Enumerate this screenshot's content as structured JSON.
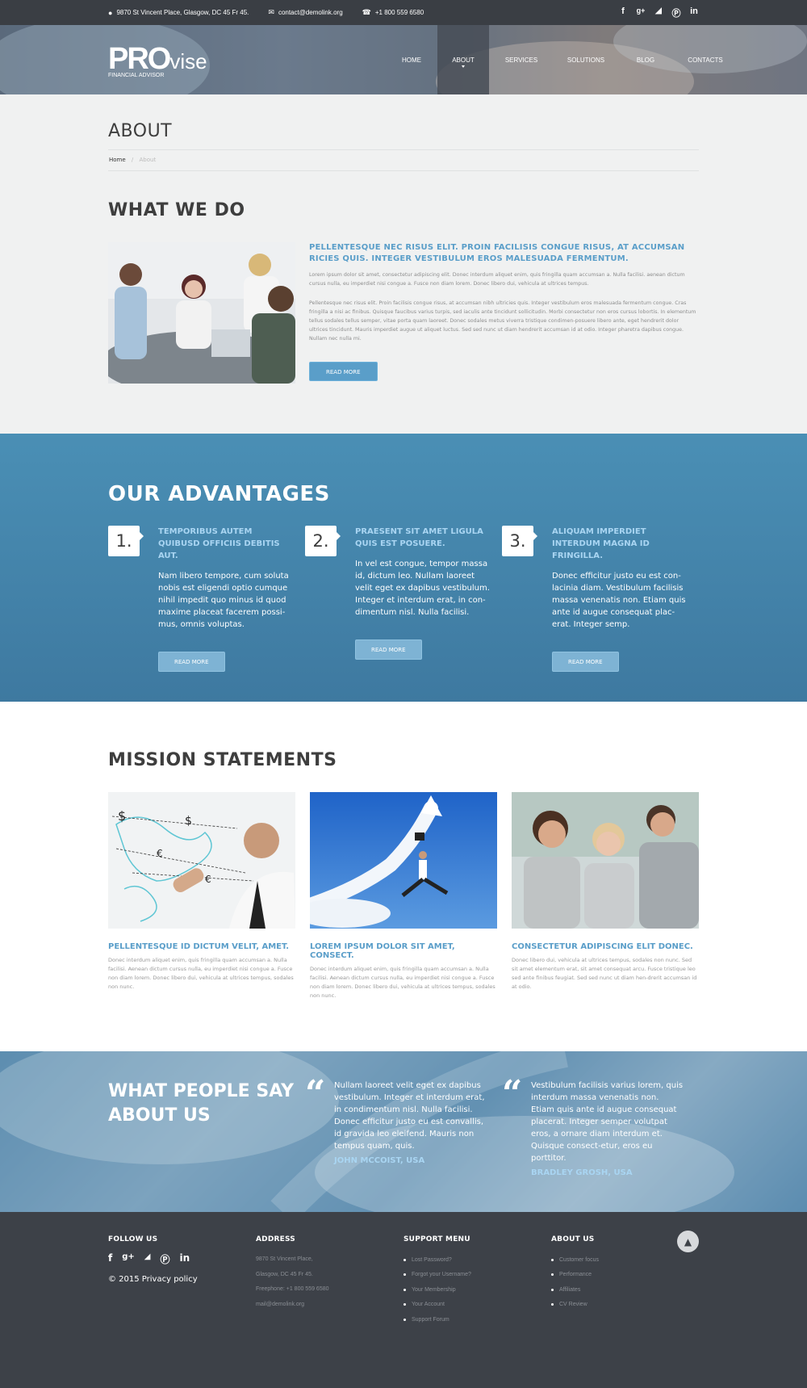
{
  "topbar": {
    "address": "9870 St Vincent Place, Glasgow, DC 45 Fr 45.",
    "email": "contact@demolink.org",
    "phone": "+1 800 559 6580",
    "social": [
      "f",
      "g+",
      "rss",
      "p",
      "in"
    ]
  },
  "logo": {
    "pro": "PRO",
    "vise": "vise",
    "sub": "FINANCIAL ADVISOR"
  },
  "nav": [
    "HOME",
    "ABOUT",
    "SERVICES",
    "SOLUTIONS",
    "BLOG",
    "CONTACTS"
  ],
  "nav_active": "ABOUT",
  "about": {
    "title": "ABOUT",
    "breadcrumb_home": "Home",
    "breadcrumb_sep": "/",
    "breadcrumb_current": "About",
    "section_title": "WHAT WE DO",
    "heading": "PELLENTESQUE NEC RISUS ELIT. PROIN FACILISIS CONGUE RISUS, AT ACCUMSAN RICIES QUIS. INTEGER VESTIBULUM EROS MALESUADA FERMENTUM.",
    "p1": "Lorem ipsum dolor sit amet, consectetur adipiscing elit. Donec interdum aliquet enim, quis fringilla quam accumsan a. Nulla facilisi. aenean dictum cursus nulla, eu imperdiet nisi congue a. Fusce non diam lorem. Donec libero dui, vehicula at ultrices tempus.",
    "p2": "Pellentesque nec risus elit. Proin facilisis congue risus, at accumsan nibh ultricies quis. Integer vestibulum eros malesuada fermentum congue. Cras fringilla a nisi ac finibus. Quisque faucibus varius turpis, sed iaculis ante tincidunt sollicitudin. Morbi consectetur non eros cursus lobortis. In elementum tellus sodales tellus semper, vitae porta quam laoreet. Donec sodales metus viverra tristique condimen-posuere libero ante, eget hendrerit dolor ultrices tincidunt. Mauris imperdiet augue ut aliquet luctus. Sed sed nunc ut diam hendrerit accumsan id at odio. Integer pharetra dapibus congue. Nullam nec nulla mi.",
    "button": "READ MORE"
  },
  "advantages": {
    "title": "OUR ADVANTAGES",
    "items": [
      {
        "num": "1.",
        "head": "TEMPORIBUS AUTEM QUIBUSD OFFICIIS DEBITIS AUT.",
        "text": "Nam libero tempore, cum soluta nobis est eligendi optio cumque nihil impedit quo minus id quod maxime placeat facerem possi-mus, omnis voluptas.",
        "button": "READ MORE"
      },
      {
        "num": "2.",
        "head": "PRAESENT SIT AMET LIGULA QUIS EST POSUERE.",
        "text": "In vel est congue, tempor massa id, dictum leo. Nullam laoreet velit eget ex dapibus vestibulum. Integer et interdum erat, in con-dimentum nisl. Nulla facilisi.",
        "button": "READ MORE"
      },
      {
        "num": "3.",
        "head": "ALIQUAM IMPERDIET INTERDUM MAGNA ID FRINGILLA.",
        "text": "Donec efficitur justo eu est con-lacinia diam. Vestibulum facilisis massa venenatis non. Etiam quis ante id augue consequat plac-erat. Integer semp.",
        "button": "READ MORE"
      }
    ]
  },
  "mission": {
    "title": "MISSION STATEMENTS",
    "items": [
      {
        "head": "PELLENTESQUE ID DICTUM VELIT, AMET.",
        "text": "Donec interdum aliquet enim, quis fringilla quam accumsan a. Nulla facilisi. Aenean dictum cursus nulla, eu imperdiet nisi congue a. Fusce non diam lorem. Donec libero dui, vehicula at ultrices tempus, sodales non nunc."
      },
      {
        "head": "LOREM IPSUM DOLOR SIT AMET, CONSECT.",
        "text": "Donec interdum aliquet enim, quis fringilla quam accumsan a. Nulla facilisi. Aenean dictum cursus nulla, eu imperdiet nisi congue a. Fusce non diam lorem. Donec libero dui, vehicula at ultrices tempus, sodales non nunc."
      },
      {
        "head": "CONSECTETUR ADIPISCING ELIT DONEC.",
        "text": "Donec libero dui, vehicula at ultrices tempus, sodales non nunc. Sed sit amet elementum erat, sit amet consequat arcu. Fusce tristique leo sed ante finibus feugiat. Sed sed nunc ut diam hen-drerit accumsan id at odio."
      }
    ]
  },
  "testimonials": {
    "title": "WHAT PEOPLE SAY ABOUT US",
    "items": [
      {
        "text": "Nullam laoreet velit eget ex dapibus vestibulum. Integer et interdum erat, in condimentum nisl. Nulla facilisi. Donec efficitur justo eu est convallis, id gravida leo eleifend. Mauris non tempus quam, quis.",
        "author": "JOHN MCCOIST, USA"
      },
      {
        "text": "Vestibulum facilisis varius lorem, quis interdum massa venenatis non. Etiam quis ante id augue consequat placerat. Integer semper volutpat eros, a ornare diam interdum et. Quisque consect-etur, eros eu porttitor.",
        "author": "BRADLEY GROSH, USA"
      }
    ]
  },
  "footer": {
    "follow": "FOLLOW US",
    "social": [
      "f",
      "g+",
      "rss",
      "p",
      "in"
    ],
    "copyright": "© 2015 Privacy policy",
    "address_head": "ADDRESS",
    "address_lines": [
      "9870 St Vincent Place,",
      "Glasgow, DC 45 Fr 45.",
      "Freephone:  +1 800 559 6580",
      "mail@demolink.org"
    ],
    "support_head": "SUPPORT MENU",
    "support_items": [
      "Lost Password?",
      "Forgot your Username?",
      "Your Membership",
      "Your Account",
      "Support Forum"
    ],
    "about_head": "ABOUT US",
    "about_items": [
      "Customer focus",
      "Performance",
      "Affiliates",
      "CV Review"
    ]
  }
}
